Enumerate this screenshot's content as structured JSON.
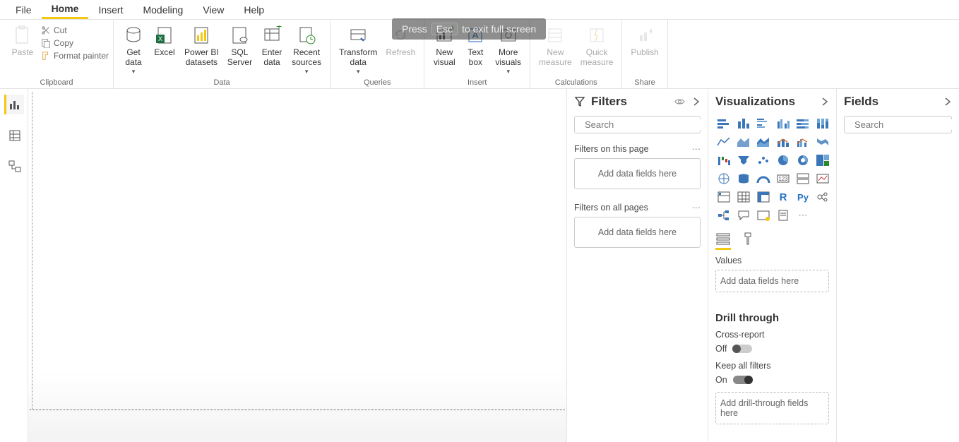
{
  "overlay": {
    "press": "Press",
    "key": "Esc",
    "rest": "to exit full screen"
  },
  "menu": {
    "file": "File",
    "tabs": [
      "Home",
      "Insert",
      "Modeling",
      "View",
      "Help"
    ],
    "active": "Home"
  },
  "ribbon": {
    "groups": {
      "clipboard": {
        "label": "Clipboard",
        "paste": "Paste",
        "cut": "Cut",
        "copy": "Copy",
        "format_painter": "Format painter"
      },
      "data": {
        "label": "Data",
        "get_data": "Get\ndata",
        "excel": "Excel",
        "pbi_ds": "Power BI\ndatasets",
        "sql": "SQL\nServer",
        "enter": "Enter\ndata",
        "recent": "Recent\nsources"
      },
      "queries": {
        "label": "Queries",
        "transform": "Transform\ndata",
        "refresh": "Refresh"
      },
      "insert": {
        "label": "Insert",
        "new_visual": "New\nvisual",
        "text_box": "Text\nbox",
        "more": "More\nvisuals"
      },
      "calc": {
        "label": "Calculations",
        "new_measure": "New\nmeasure",
        "quick": "Quick\nmeasure"
      },
      "share": {
        "label": "Share",
        "publish": "Publish"
      }
    }
  },
  "rail": {
    "report": "report-view",
    "data": "data-view",
    "model": "model-view"
  },
  "filters": {
    "title": "Filters",
    "search_ph": "Search",
    "this_page": "Filters on this page",
    "all_pages": "Filters on all pages",
    "add": "Add data fields here"
  },
  "viz": {
    "title": "Visualizations",
    "values": "Values",
    "add": "Add data fields here",
    "drill": "Drill through",
    "cross": "Cross-report",
    "off": "Off",
    "keep": "Keep all filters",
    "on": "On",
    "add_drill": "Add drill-through fields here"
  },
  "fields": {
    "title": "Fields",
    "search_ph": "Search"
  }
}
